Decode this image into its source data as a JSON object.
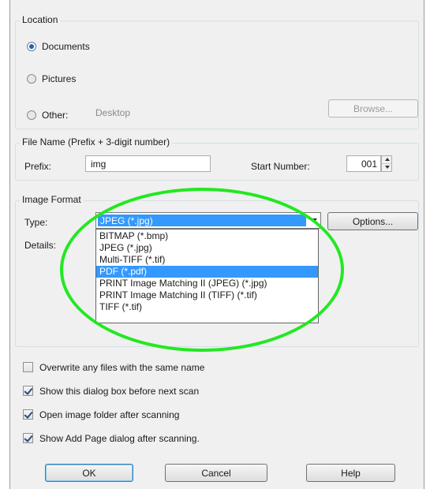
{
  "location": {
    "group_label": "Location",
    "documents_label": "Documents",
    "pictures_label": "Pictures",
    "other_label": "Other:",
    "other_value": "Desktop",
    "browse_label": "Browse..."
  },
  "file_name": {
    "group_label": "File Name (Prefix + 3-digit number)",
    "prefix_label": "Prefix:",
    "prefix_value": "img",
    "start_number_label": "Start Number:",
    "start_number_value": "001"
  },
  "image_format": {
    "group_label": "Image Format",
    "type_label": "Type:",
    "type_value": "JPEG (*.jpg)",
    "details_label": "Details:",
    "options_label": "Options...",
    "options": [
      "BITMAP (*.bmp)",
      "JPEG (*.jpg)",
      "Multi-TIFF (*.tif)",
      "PDF (*.pdf)",
      "PRINT Image Matching II (JPEG) (*.jpg)",
      "PRINT Image Matching II (TIFF) (*.tif)",
      "TIFF (*.tif)"
    ],
    "highlighted_index": 3
  },
  "checkboxes": {
    "overwrite": {
      "label": "Overwrite any files with the same name",
      "checked": false
    },
    "show_dialog": {
      "label": "Show this dialog box before next scan",
      "checked": true
    },
    "open_folder": {
      "label": "Open image folder after scanning",
      "checked": true
    },
    "add_page": {
      "label": "Show Add Page dialog after scanning.",
      "checked": true
    }
  },
  "buttons": {
    "ok": "OK",
    "cancel": "Cancel",
    "help": "Help"
  },
  "colors": {
    "selection": "#3399ff",
    "annotation": "#22e822"
  }
}
